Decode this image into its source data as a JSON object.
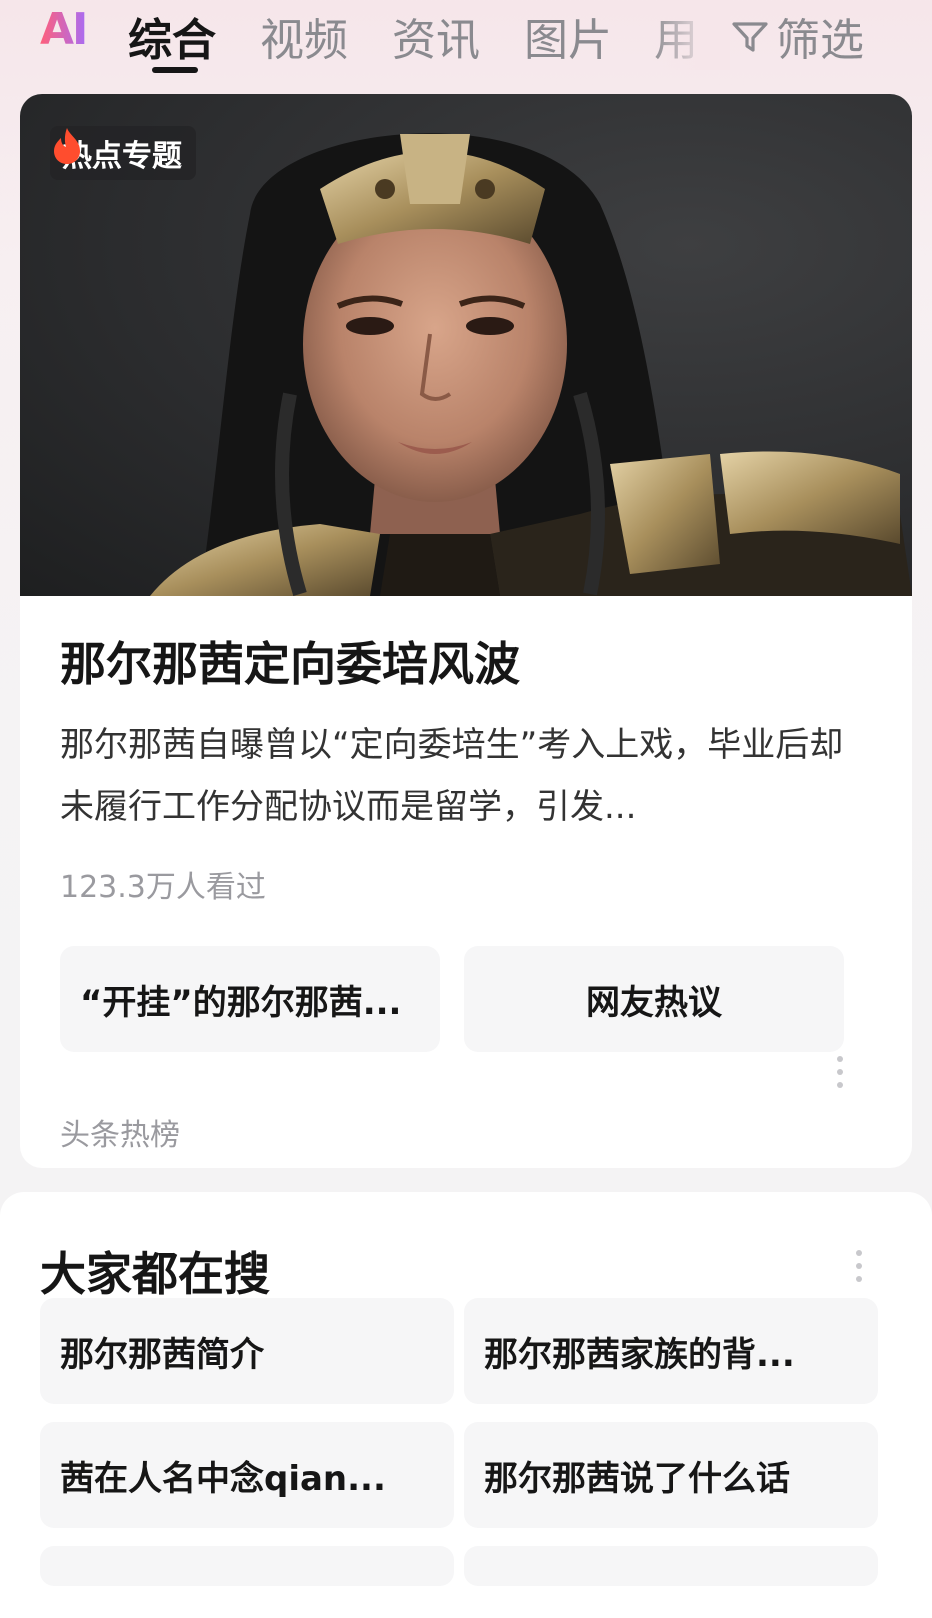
{
  "tabs": {
    "ai_label": "AI",
    "items": [
      "综合",
      "视频",
      "资讯",
      "图片",
      "用"
    ],
    "active_index": 0,
    "filter_label": "筛选"
  },
  "topic_card": {
    "badge": "热点专题",
    "title": "那尔那茜定向委培风波",
    "description": "那尔那茜自曝曾以“定向委培生”考入上戏，毕业后却未履行工作分配协议而是留学，引发...",
    "views": "123.3万人看过",
    "buttons": [
      "“开挂”的那尔那茜...",
      "网友热议"
    ],
    "source": "头条热榜"
  },
  "related_search": {
    "title": "大家都在搜",
    "items": [
      "那尔那茜简介",
      "那尔那茜家族的背...",
      "茜在人名中念qian...",
      "那尔那茜说了什么话"
    ]
  },
  "colors": {
    "accent_flame": "#ff4d2e",
    "ai_gradient_start": "#ff5f7a",
    "ai_gradient_end": "#a96cf2"
  },
  "icons": [
    "flame-icon",
    "filter-icon",
    "more-icon"
  ]
}
